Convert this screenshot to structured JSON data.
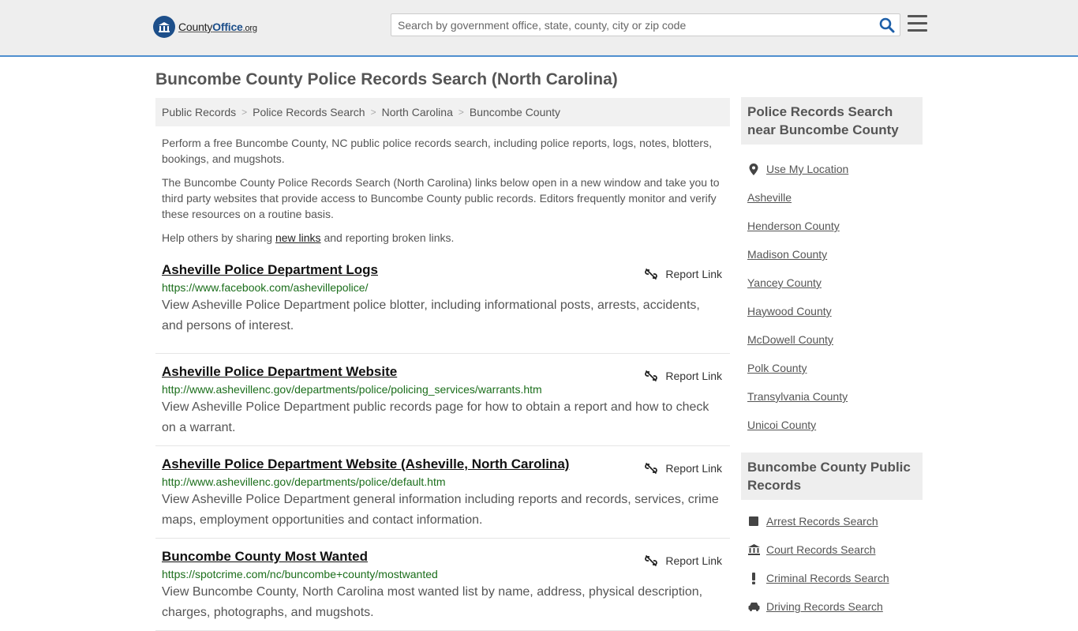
{
  "header": {
    "logo": {
      "county": "County",
      "office": "Office",
      "org": ".org"
    },
    "search_placeholder": "Search by government office, state, county, city or zip code"
  },
  "page_title": "Buncombe County Police Records Search (North Carolina)",
  "breadcrumb": [
    {
      "label": "Public Records"
    },
    {
      "label": "Police Records Search"
    },
    {
      "label": "North Carolina"
    },
    {
      "label": "Buncombe County"
    }
  ],
  "intro": {
    "p1": "Perform a free Buncombe County, NC public police records search, including police reports, logs, notes, blotters, bookings, and mugshots.",
    "p2": "The Buncombe County Police Records Search (North Carolina) links below open in a new window and take you to third party websites that provide access to Buncombe County public records. Editors frequently monitor and verify these resources on a routine basis.",
    "p3_before": "Help others by sharing ",
    "p3_link": "new links",
    "p3_after": " and reporting broken links."
  },
  "report_label": "Report Link",
  "results": [
    {
      "title": "Asheville Police Department Logs",
      "url": "https://www.facebook.com/ashevillepolice/",
      "desc": "View Asheville Police Department police blotter, including informational posts, arrests, accidents, and persons of interest."
    },
    {
      "title": "Asheville Police Department Website",
      "url": "http://www.ashevillenc.gov/departments/police/policing_services/warrants.htm",
      "desc": "View Asheville Police Department public records page for how to obtain a report and how to check on a warrant."
    },
    {
      "title": "Asheville Police Department Website (Asheville, North Carolina)",
      "url": "http://www.ashevillenc.gov/departments/police/default.htm",
      "desc": "View Asheville Police Department general information including reports and records, services, crime maps, employment opportunities and contact information."
    },
    {
      "title": "Buncombe County Most Wanted",
      "url": "https://spotcrime.com/nc/buncombe+county/mostwanted",
      "desc": "View Buncombe County, North Carolina most wanted list by name, address, physical description, charges, photographs, and mugshots."
    }
  ],
  "sidebar": {
    "nearby_heading": "Police Records Search near Buncombe County",
    "use_location": "Use My Location",
    "nearby": [
      "Asheville",
      "Henderson County",
      "Madison County",
      "Yancey County",
      "Haywood County",
      "McDowell County",
      "Polk County",
      "Transylvania County",
      "Unicoi County"
    ],
    "records_heading": "Buncombe County Public Records",
    "records": [
      {
        "label": "Arrest Records Search",
        "icon": "square-icon"
      },
      {
        "label": "Court Records Search",
        "icon": "courthouse-icon"
      },
      {
        "label": "Criminal Records Search",
        "icon": "exclamation-icon"
      },
      {
        "label": "Driving Records Search",
        "icon": "car-icon"
      }
    ]
  },
  "colors": {
    "accent": "#4f8fcf",
    "link_url": "#1b6e1b",
    "logo_blue": "#1d4f8a"
  }
}
